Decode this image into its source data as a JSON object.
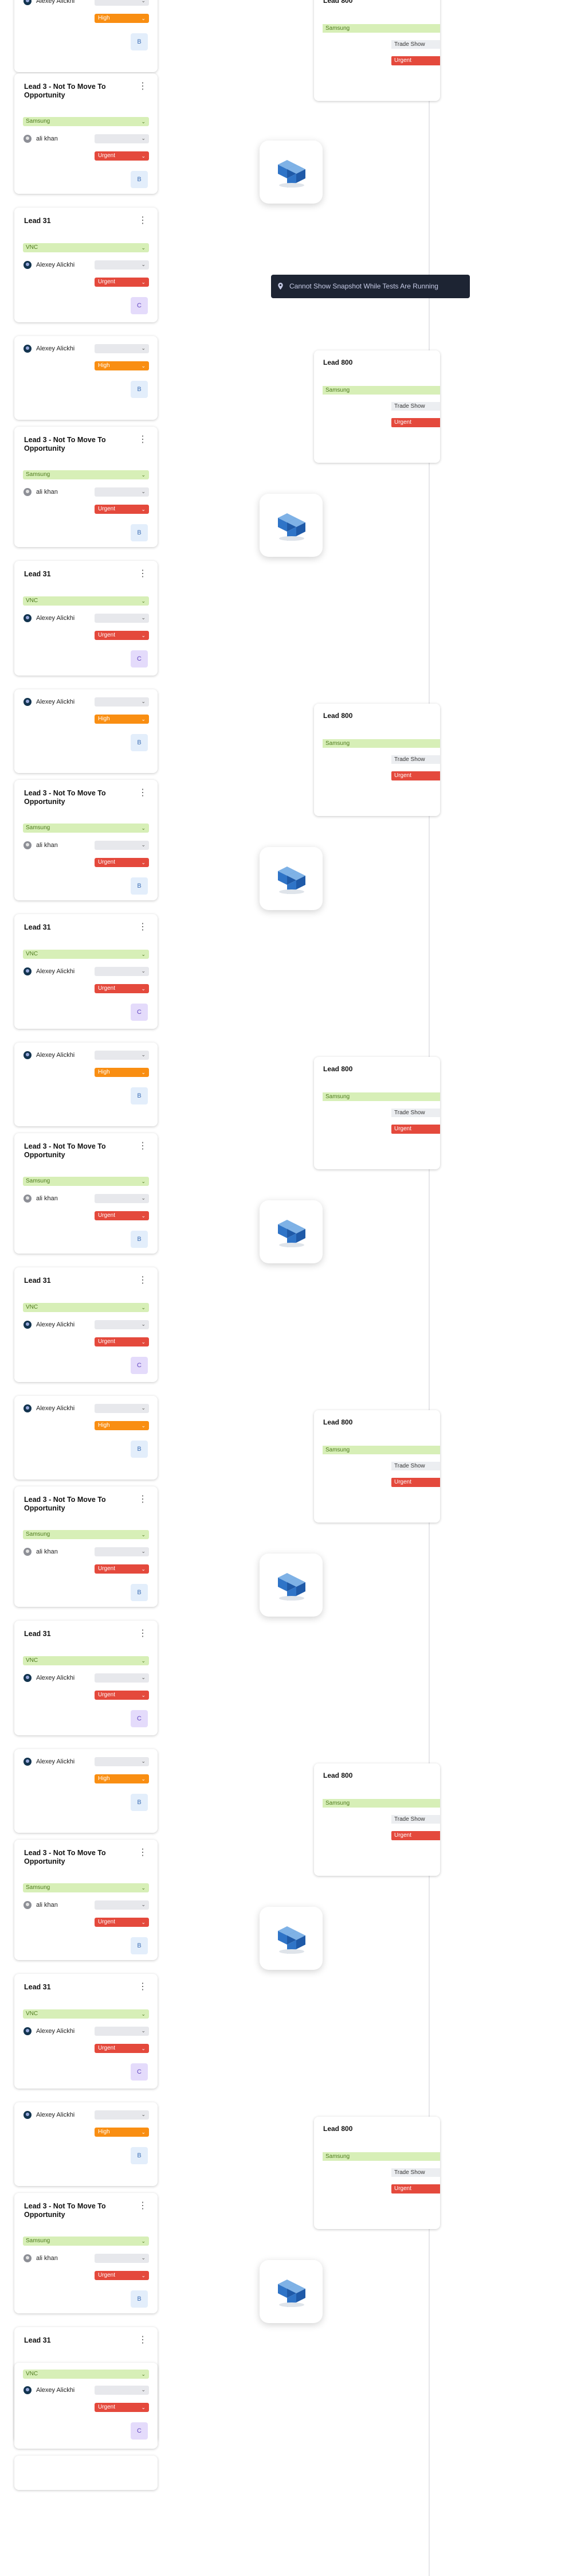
{
  "tooltip": {
    "text": "Cannot Show Snapshot While Tests Are Running",
    "icon": "pin-icon"
  },
  "left_cards": [
    {
      "title": "",
      "company": "",
      "owner": "Alexey Alickhi",
      "avatar": "dark",
      "priority": "High",
      "priority_type": "high",
      "initial": "B",
      "initial_type": "b"
    },
    {
      "title": "Lead 3 - Not To Move To Opportunity",
      "company": "Samsung",
      "owner": "ali khan",
      "avatar": "grey",
      "priority": "Urgent",
      "priority_type": "urgent",
      "initial": "B",
      "initial_type": "b"
    },
    {
      "title": "Lead 31",
      "company": "VNC",
      "owner": "Alexey Alickhi",
      "avatar": "dark",
      "priority": "Urgent",
      "priority_type": "urgent",
      "initial": "C",
      "initial_type": "c"
    }
  ],
  "right_card": {
    "title": "Lead 800",
    "company": "Samsung",
    "tag": "Trade Show",
    "priority": "Urgent"
  },
  "last_card": {
    "company": "VNC",
    "owner": "Alexey Alickhi",
    "priority": "Urgent",
    "initial": "C"
  }
}
